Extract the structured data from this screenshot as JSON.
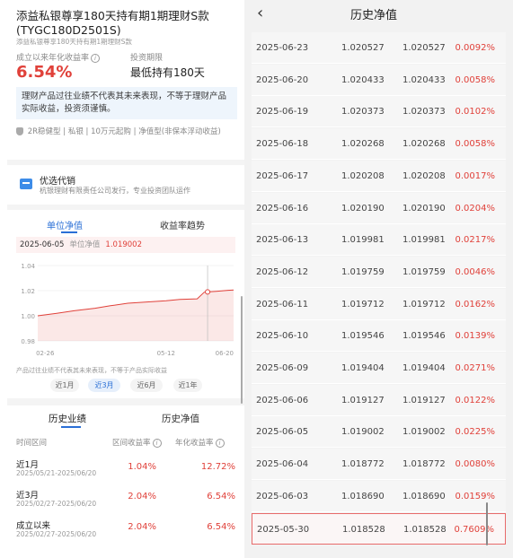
{
  "product": {
    "title": "添益私银尊享180天持有期1期理财S款(TYGC180D2501S)",
    "subtitle": "添益私银尊享180天持有期1期理财S款",
    "rate_label": "成立以来年化收益率",
    "info_icon": "i",
    "period_label": "投资期限",
    "rate_value": "6.54%",
    "hold_value": "最低持有180天",
    "warning": "理财产品过往业绩不代表其未来表现，不等于理财产品实际收益，投资须谨慎。",
    "tags": [
      "2R稳健型",
      "私银",
      "10万元起购",
      "净值型(非保本浮动收益)"
    ],
    "tag_separator": "|"
  },
  "seller": {
    "title": "优选代销",
    "desc": "杭银理财有限责任公司发行，专业投资团队运作"
  },
  "chart_tabs": [
    "单位净值",
    "收益率趋势"
  ],
  "tooltip": {
    "date": "2025-06-05",
    "label": "单位净值",
    "value": "1.019002"
  },
  "chart_data": {
    "type": "area",
    "x_ticks": [
      "02-26",
      "05-12",
      "06-20"
    ],
    "y_ticks": [
      "1.04",
      "1.02",
      "1.00",
      "0.98"
    ],
    "ylim": [
      0.98,
      1.04
    ],
    "x": [
      "2025-02-27",
      "2025-03-10",
      "2025-03-20",
      "2025-04-01",
      "2025-04-10",
      "2025-04-20",
      "2025-05-01",
      "2025-05-12",
      "2025-05-20",
      "2025-05-30",
      "2025-06-03",
      "2025-06-05",
      "2025-06-10",
      "2025-06-16",
      "2025-06-20"
    ],
    "values": [
      1.0,
      1.002,
      1.004,
      1.006,
      1.008,
      1.01,
      1.011,
      1.012,
      1.013,
      1.0135,
      1.0187,
      1.019,
      1.0195,
      1.0202,
      1.0205
    ],
    "highlight": "2025-06-05",
    "color": "#e0413a"
  },
  "chart_note": "产品过往业绩不代表其未来表现，不等于产品实际收益",
  "ranges": [
    {
      "label": "近1月",
      "active": false
    },
    {
      "label": "近3月",
      "active": true
    },
    {
      "label": "近6月",
      "active": false
    },
    {
      "label": "近1年",
      "active": false
    }
  ],
  "perf_tabs": [
    "历史业绩",
    "历史净值"
  ],
  "perf_headers": [
    "时间区间",
    "区间收益率",
    "年化收益率"
  ],
  "perf_rows": [
    {
      "name": "近1月",
      "dates": "2025/05/21-2025/06/20",
      "range": "1.04%",
      "annual": "12.72%"
    },
    {
      "name": "近3月",
      "dates": "2025/02/27-2025/06/20",
      "range": "2.04%",
      "annual": "6.54%"
    },
    {
      "name": "成立以来",
      "dates": "2025/02/27-2025/06/20",
      "range": "2.04%",
      "annual": "6.54%"
    }
  ],
  "nav_page": {
    "back_icon": "‹",
    "title": "历史净值",
    "rows": [
      {
        "date": "2025-06-23",
        "unit": "1.020527",
        "acc": "1.020527",
        "change": "0.0092%"
      },
      {
        "date": "2025-06-20",
        "unit": "1.020433",
        "acc": "1.020433",
        "change": "0.0058%"
      },
      {
        "date": "2025-06-19",
        "unit": "1.020373",
        "acc": "1.020373",
        "change": "0.0102%"
      },
      {
        "date": "2025-06-18",
        "unit": "1.020268",
        "acc": "1.020268",
        "change": "0.0058%"
      },
      {
        "date": "2025-06-17",
        "unit": "1.020208",
        "acc": "1.020208",
        "change": "0.0017%"
      },
      {
        "date": "2025-06-16",
        "unit": "1.020190",
        "acc": "1.020190",
        "change": "0.0204%"
      },
      {
        "date": "2025-06-13",
        "unit": "1.019981",
        "acc": "1.019981",
        "change": "0.0217%"
      },
      {
        "date": "2025-06-12",
        "unit": "1.019759",
        "acc": "1.019759",
        "change": "0.0046%"
      },
      {
        "date": "2025-06-11",
        "unit": "1.019712",
        "acc": "1.019712",
        "change": "0.0162%"
      },
      {
        "date": "2025-06-10",
        "unit": "1.019546",
        "acc": "1.019546",
        "change": "0.0139%"
      },
      {
        "date": "2025-06-09",
        "unit": "1.019404",
        "acc": "1.019404",
        "change": "0.0271%"
      },
      {
        "date": "2025-06-06",
        "unit": "1.019127",
        "acc": "1.019127",
        "change": "0.0122%"
      },
      {
        "date": "2025-06-05",
        "unit": "1.019002",
        "acc": "1.019002",
        "change": "0.0225%"
      },
      {
        "date": "2025-06-04",
        "unit": "1.018772",
        "acc": "1.018772",
        "change": "0.0080%"
      },
      {
        "date": "2025-06-03",
        "unit": "1.018690",
        "acc": "1.018690",
        "change": "0.0159%"
      },
      {
        "date": "2025-05-30",
        "unit": "1.018528",
        "acc": "1.018528",
        "change": "0.7609%",
        "highlighted": true
      }
    ]
  }
}
